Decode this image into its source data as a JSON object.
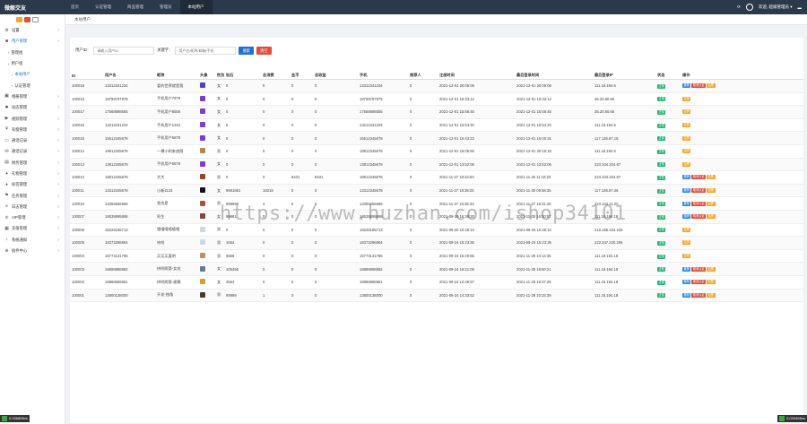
{
  "app": {
    "logo": "微鲸交友"
  },
  "topnav": {
    "tabs": [
      "首页",
      "认证管理",
      "商品管理",
      "管理员",
      "本站用户"
    ],
    "active_index": 4,
    "user_label": "欢迎, 超级管理员 ▾"
  },
  "sidebar": {
    "items": [
      {
        "label": "设置",
        "icon": "gear-icon"
      },
      {
        "label": "用户管理",
        "icon": "users-icon",
        "active": true
      },
      {
        "label": "管理组",
        "level": 1
      },
      {
        "label": "用户组",
        "level": 1
      },
      {
        "label": "本站用户",
        "level": 2,
        "active": true
      },
      {
        "label": "认证管理",
        "level": 2
      },
      {
        "label": "相册管理",
        "icon": "image-icon"
      },
      {
        "label": "动态管理",
        "icon": "flame-icon"
      },
      {
        "label": "视频管理",
        "icon": "video-icon"
      },
      {
        "label": "有偿管理",
        "icon": "money-icon"
      },
      {
        "label": "通话记录",
        "icon": "monitor-icon"
      },
      {
        "label": "通话记录",
        "icon": "chat-icon"
      },
      {
        "label": "财务管理",
        "icon": "wallet-icon"
      },
      {
        "label": "礼物管理",
        "icon": "gift-icon"
      },
      {
        "label": "标签管理",
        "icon": "tag-icon"
      },
      {
        "label": "任务管理",
        "icon": "flag-icon"
      },
      {
        "label": "日志管理",
        "icon": "log-icon"
      },
      {
        "label": "VIP管理",
        "icon": "crown-icon"
      },
      {
        "label": "充值管理",
        "icon": "card-icon"
      },
      {
        "label": "系统通知",
        "icon": "bell-icon"
      },
      {
        "label": "插件中心",
        "icon": "plugin-icon"
      }
    ]
  },
  "breadcrumb": "本站用户",
  "filter": {
    "user_id_label": "用户ID：",
    "user_id_placeholder": "请输入用户ID",
    "keyword_label": "关键字：",
    "keyword_placeholder": "用户名/昵称/邮箱/手机",
    "search_label": "搜索",
    "clear_label": "清空"
  },
  "table": {
    "headers": [
      "ID",
      "用户名",
      "昵称",
      "头像",
      "性别",
      "钻石",
      "总消费",
      "金币",
      "总收益",
      "手机",
      "推荐人",
      "注册时间",
      "最后登录时间",
      "最后登录IP",
      "状态",
      "操作"
    ],
    "status_label": "正常",
    "op_labels": [
      "推荐",
      "取消认证",
      "拉黑"
    ],
    "rows": [
      {
        "id": "100019",
        "username": "13312341234",
        "nick": "爱的世界就是我",
        "sex": "女",
        "bal": "0",
        "cons": "0",
        "gold": "0",
        "earn": "0",
        "mobile": "13312341234",
        "rec": "0",
        "reg": "2021-12-01 20:05:08",
        "last": "2021-12-01 20:05:08",
        "ip": "111.18.194.5",
        "ops": 3,
        "avatar": "#4a3fd0"
      },
      {
        "id": "100018",
        "username": "18799797979",
        "nick": "手机用户7979",
        "sex": "女",
        "bal": "0",
        "cons": "0",
        "gold": "0",
        "earn": "0",
        "mobile": "18799797979",
        "rec": "0",
        "reg": "2021-12-01 16:33:12",
        "last": "2021-12-01 16:33:12",
        "ip": "36.20.80.66",
        "ops": 1,
        "avatar": "#7a3fd0"
      },
      {
        "id": "100017",
        "username": "17568888555",
        "nick": "手机用户8555",
        "sex": "女",
        "bal": "0",
        "cons": "0",
        "gold": "0",
        "earn": "0",
        "mobile": "17568888555",
        "rec": "0",
        "reg": "2021-12-01 15:56:45",
        "last": "2021-12-01 15:56:45",
        "ip": "36.20.80.66",
        "ops": 1,
        "avatar": "#7a3fd0"
      },
      {
        "id": "100016",
        "username": "13212341234",
        "nick": "手机用户1234",
        "sex": "女",
        "bal": "0",
        "cons": "0",
        "gold": "0",
        "earn": "0",
        "mobile": "13212341234",
        "rec": "0",
        "reg": "2021-12-01 15:54:20",
        "last": "2021-12-01 15:54:20",
        "ip": "111.18.194.5",
        "ops": 1,
        "avatar": "#7a3fd0"
      },
      {
        "id": "100015",
        "username": "15512345678",
        "nick": "手机用户5678",
        "sex": "女",
        "bal": "0",
        "cons": "0",
        "gold": "0",
        "earn": "0",
        "mobile": "15512345678",
        "rec": "0",
        "reg": "2021-12-01 15:43:23",
        "last": "2021-12-01 16:00:31",
        "ip": "117.136.87.15",
        "ops": 1,
        "avatar": "#7a3fd0"
      },
      {
        "id": "100014",
        "username": "19912345678",
        "nick": "一棵小树来遮荫",
        "sex": "男",
        "bal": "0",
        "cons": "0",
        "gold": "0",
        "earn": "0",
        "mobile": "19912345678",
        "rec": "0",
        "reg": "2021-12-01 15:05:55",
        "last": "2021-12-01 20:15:18",
        "ip": "111.18.194.5",
        "ops": 1,
        "avatar": "#b08850"
      },
      {
        "id": "100013",
        "username": "13812345678",
        "nick": "手机用户5678",
        "sex": "女",
        "bal": "0",
        "cons": "0",
        "gold": "0",
        "earn": "0",
        "mobile": "13812345678",
        "rec": "0",
        "reg": "2021-12-01 13:52:06",
        "last": "2021-12-01 13:52:06",
        "ip": "223.104.204.67",
        "ops": 1,
        "avatar": "#7a3fd0"
      },
      {
        "id": "100012",
        "username": "18812345678",
        "nick": "大大",
        "sex": "男",
        "bal": "0",
        "cons": "0",
        "gold": "8431",
        "earn": "8431",
        "mobile": "18812345678",
        "rec": "0",
        "reg": "2021-11-27 18:43:53",
        "last": "2021-11-30 11:18:23",
        "ip": "223.104.204.67",
        "ops": 3,
        "avatar": "#8a4a2a"
      },
      {
        "id": "100011",
        "username": "13312345678",
        "nick": "小新1123",
        "sex": "女",
        "bal": "9981681",
        "cons": "18318",
        "gold": "0",
        "earn": "0",
        "mobile": "13312345678",
        "rec": "0",
        "reg": "2021-11-27 18:38:25",
        "last": "2021-11-30 09:58:35",
        "ip": "117.136.87.46",
        "ops": 3,
        "avatar": "#111111"
      },
      {
        "id": "100010",
        "username": "13355556666",
        "nick": "我也是",
        "sex": "男",
        "bal": "999996",
        "cons": "4",
        "gold": "0",
        "earn": "0",
        "mobile": "13355556666",
        "rec": "0",
        "reg": "2021-11-27 16:36:33",
        "last": "2021-11-27 18:31:26",
        "ip": "223.104.11.20",
        "ops": 3,
        "avatar": "#9a5a3a"
      },
      {
        "id": "100007",
        "username": "18538895898",
        "nick": "阿生",
        "sex": "女",
        "bal": "99881",
        "cons": "0",
        "gold": "0",
        "earn": "0",
        "mobile": "18538895898",
        "rec": "0",
        "reg": "2021-09-29 15:38:30",
        "last": "2021-11-30 16:20:57",
        "ip": "111.18.194.18",
        "ops": 3,
        "avatar": "#7a4a3a"
      },
      {
        "id": "100006",
        "username": "18228185713",
        "nick": "嘻嘻嘻嘻嘻嘻",
        "sex": "男",
        "bal": "0",
        "cons": "0",
        "gold": "0",
        "earn": "0",
        "mobile": "18228185713",
        "rec": "0",
        "reg": "2021-09-25 10:48:10",
        "last": "2021-09-25 10:48:10",
        "ip": "219.155.154.245",
        "ops": 1,
        "avatar": "#cfd8e0"
      },
      {
        "id": "100005",
        "username": "18373286864",
        "nick": "哈哈",
        "sex": "男",
        "bal": "1654",
        "cons": "0",
        "gold": "0",
        "earn": "0",
        "mobile": "18373286864",
        "rec": "0",
        "reg": "2021-09-24 15:23:35",
        "last": "2021-09-24 15:23:35",
        "ip": "222.247.220.206",
        "ops": 1,
        "avatar": "#cfd8e0"
      },
      {
        "id": "100004",
        "username": "15773131785",
        "nick": "买买买要明",
        "sex": "男",
        "bal": "6666",
        "cons": "0",
        "gold": "0",
        "earn": "0",
        "mobile": "15773131785",
        "rec": "0",
        "reg": "2021-09-24 15:20:55",
        "last": "2021-11-28 10:14:35",
        "ip": "111.18.194.18",
        "ops": 1,
        "avatar": "#c09060"
      },
      {
        "id": "100003",
        "username": "18888888882",
        "nick": "拼明两第-女炫",
        "sex": "女",
        "bal": "105456",
        "cons": "0",
        "gold": "0",
        "earn": "0",
        "mobile": "18888888882",
        "rec": "0",
        "reg": "2021-09-24 15:21:09",
        "last": "2021-11-28 19:50:21",
        "ip": "111.18.194.18",
        "ops": 3,
        "avatar": "#6a7a8a"
      },
      {
        "id": "100002",
        "username": "18888888881",
        "nick": "拼明两第-建霖",
        "sex": "女",
        "bal": "4564",
        "cons": "0",
        "gold": "0",
        "earn": "0",
        "mobile": "18888888881",
        "rec": "0",
        "reg": "2021-09-24 14:49:57",
        "last": "2021-11-28 19:37:28",
        "ip": "111.18.194.18",
        "ops": 3,
        "avatar": "#d0a030"
      },
      {
        "id": "100001",
        "username": "13800138000",
        "nick": "开发-独角",
        "sex": "男",
        "bal": "99999",
        "cons": "1",
        "gold": "0",
        "earn": "0",
        "mobile": "13800138000",
        "rec": "0",
        "reg": "2021-09-24 14:33:52",
        "last": "2021-11-28 10:33:39",
        "ip": "111.18.194.18",
        "ops": 3,
        "avatar": "#4a3a2a"
      }
    ]
  },
  "watermark": "https://www.huzhan.com/ishop34101",
  "corners": {
    "left": "0.0368Mb/s",
    "right": "0.0334Mb/s"
  }
}
